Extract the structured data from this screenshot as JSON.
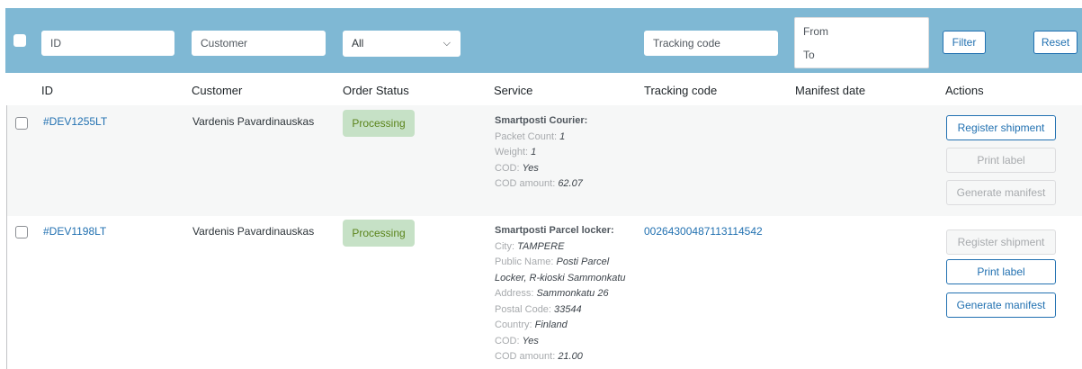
{
  "filters": {
    "id_placeholder": "ID",
    "customer_placeholder": "Customer",
    "status_selected": "All",
    "tracking_placeholder": "Tracking code",
    "date_from_label": "From",
    "date_to_label": "To",
    "filter_label": "Filter",
    "reset_label": "Reset"
  },
  "columns": [
    "ID",
    "Customer",
    "Order Status",
    "Service",
    "Tracking code",
    "Manifest date",
    "Actions"
  ],
  "orders": [
    {
      "id": "#DEV1255LT",
      "customer": "Vardenis Pavardinauskas",
      "status": "Processing",
      "service_title": "Smartposti Courier:",
      "details": [
        {
          "label": "Packet Count: ",
          "value": "1"
        },
        {
          "label": "Weight: ",
          "value": "1"
        },
        {
          "label": "COD: ",
          "value": "Yes"
        },
        {
          "label": "COD amount: ",
          "value": "62.07"
        }
      ],
      "tracking_code": "",
      "manifest_date": "",
      "actions": {
        "register": "Register shipment",
        "print": "Print label",
        "manifest": "Generate manifest"
      }
    },
    {
      "id": "#DEV1198LT",
      "customer": "Vardenis Pavardinauskas",
      "status": "Processing",
      "service_title": "Smartposti Parcel locker:",
      "details": [
        {
          "label": "City: ",
          "value": "TAMPERE"
        },
        {
          "label": "Public Name: ",
          "value": "Posti Parcel Locker, R-kioski Sammonkatu"
        },
        {
          "label": "Address: ",
          "value": "Sammonkatu 26"
        },
        {
          "label": "Postal Code: ",
          "value": "33544"
        },
        {
          "label": "Country: ",
          "value": "Finland"
        },
        {
          "label": "COD: ",
          "value": "Yes"
        },
        {
          "label": "COD amount: ",
          "value": "21.00"
        }
      ],
      "tracking_code": "00264300487113114542",
      "manifest_date": "",
      "actions": {
        "register": "Register shipment",
        "print": "Print label",
        "manifest": "Generate manifest"
      }
    }
  ]
}
